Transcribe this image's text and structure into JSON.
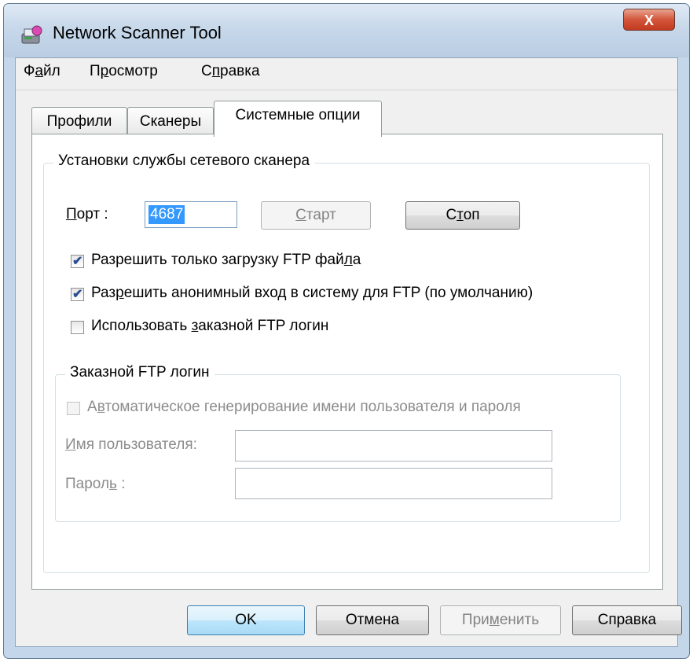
{
  "window": {
    "title": "Network Scanner Tool",
    "close_glyph": "X"
  },
  "menu": [
    {
      "pre": "Ф",
      "u": "а",
      "post": "йл"
    },
    {
      "pre": "П",
      "u": "р",
      "post": "осмотр"
    },
    {
      "pre": "С",
      "u": "п",
      "post": "равка"
    }
  ],
  "tabs": {
    "profiles": "Профили",
    "scanners": "Сканеры",
    "system": "Системные опции"
  },
  "service_group": {
    "title": "Установки службы сетевого сканера",
    "port_label_u": "П",
    "port_label_rest": "орт :",
    "port_value": "4687",
    "start_u": "С",
    "start_rest": "тарт",
    "stop_pre": "С",
    "stop_u": "т",
    "stop_post": "оп",
    "cb1_pre": "Разрешить только загрузку FTP фай",
    "cb1_u": "л",
    "cb1_post": "а",
    "cb2_pre": "Раз",
    "cb2_u": "р",
    "cb2_post": "ешить анонимный вход в систему для FTP (по умолчанию)",
    "cb3_pre": "Использовать ",
    "cb3_u": "з",
    "cb3_post": "аказной FTP логин"
  },
  "custom_group": {
    "title": "Заказной FTP логин",
    "auto_pre": "А",
    "auto_u": "в",
    "auto_post": "томатическое генерирование имени пользователя и пароля",
    "user_u": "И",
    "user_rest": "мя пользователя:",
    "pass_pre": "Парол",
    "pass_u": "ь",
    "pass_post": " :"
  },
  "buttons": {
    "ok": "OK",
    "cancel": "Отмена",
    "apply_pre": "При",
    "apply_u": "м",
    "apply_post": "енить",
    "help": "Справка"
  },
  "state": {
    "cb1_checked": true,
    "cb2_checked": true,
    "cb3_checked": false,
    "auto_checked": false
  },
  "colors": {
    "selection": "#3399ff",
    "accent_border": "#3c7fb1"
  },
  "icons": [
    "scanner-app-icon",
    "close-icon",
    "checkmark-icon"
  ]
}
